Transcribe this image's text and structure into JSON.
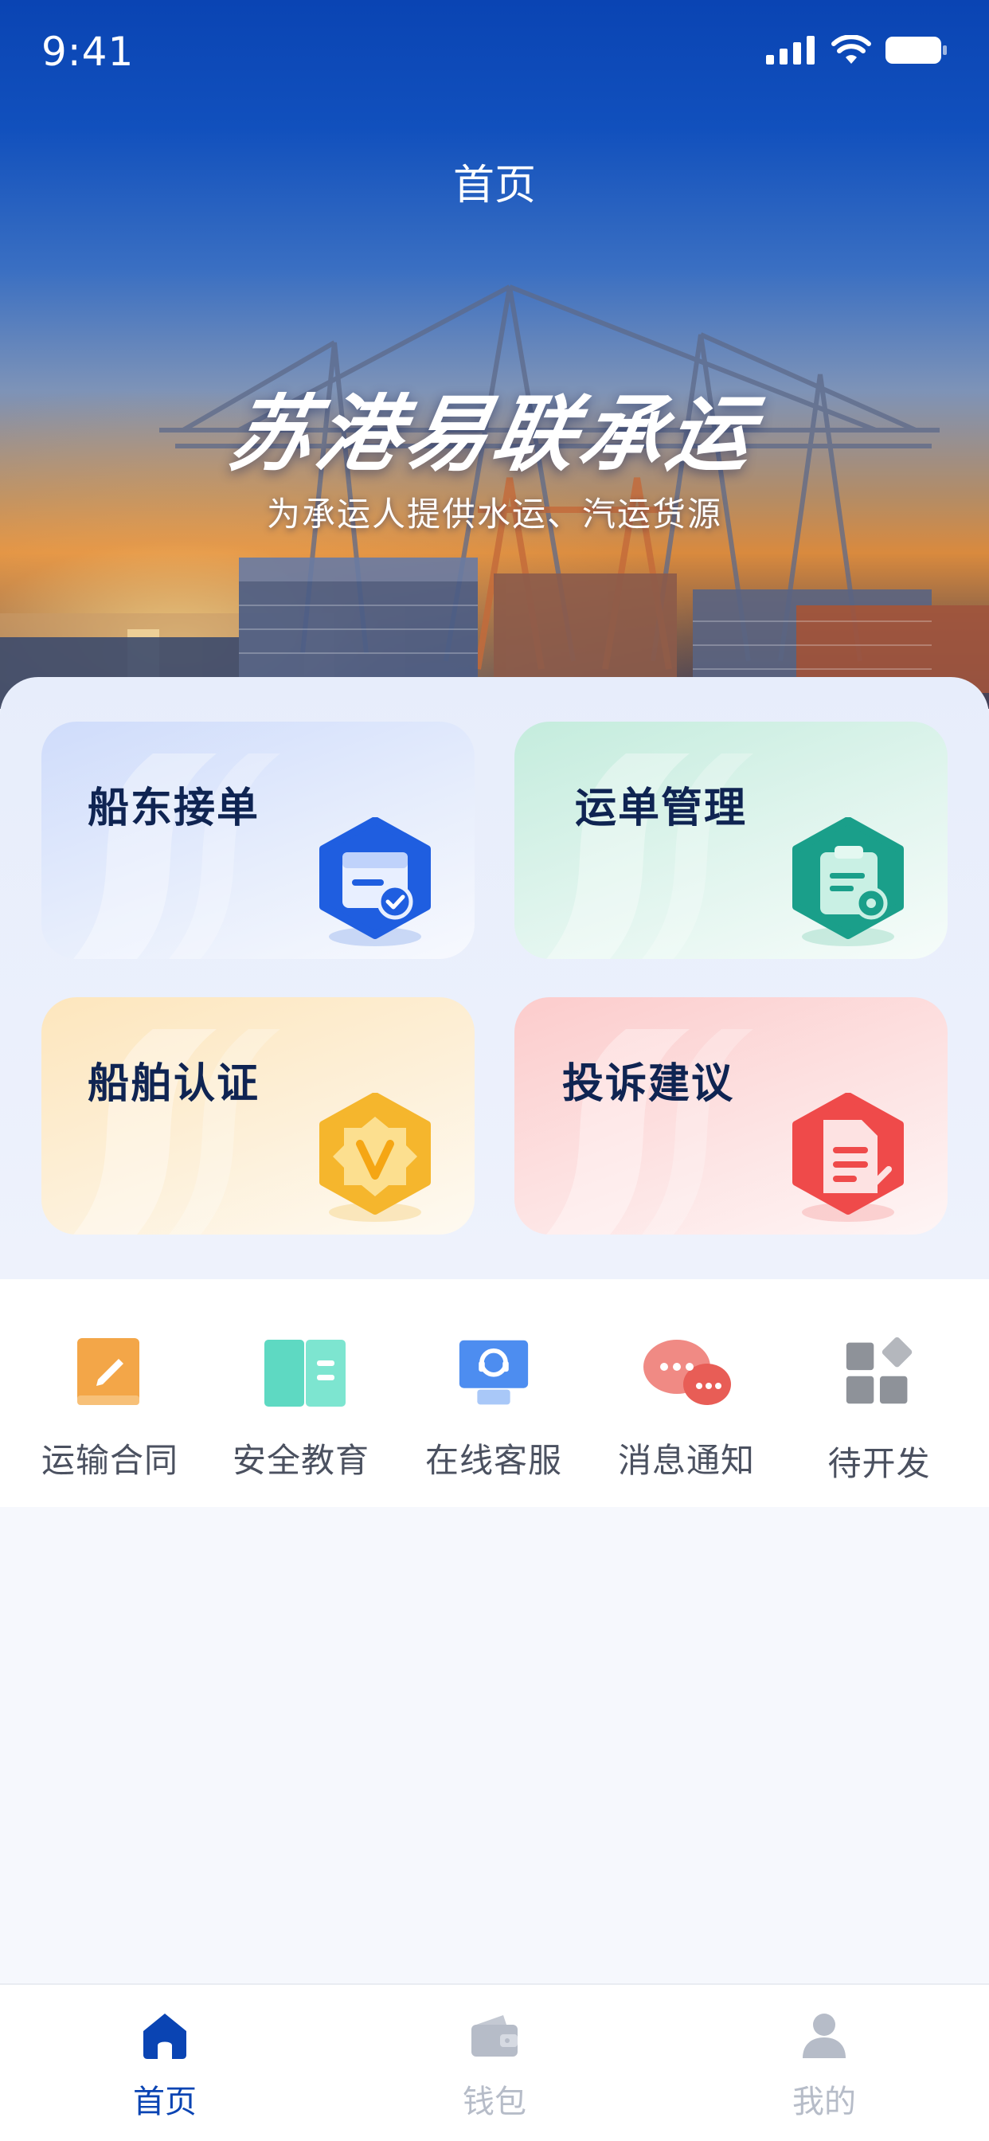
{
  "status_bar": {
    "time": "9:41"
  },
  "header": {
    "title": "首页",
    "brand": "苏港易联承运",
    "subtitle": "为承运人提供水运、汽运货源"
  },
  "cards": [
    {
      "label": "船东接单",
      "icon": "calendar-check-icon",
      "color": "#1f5ee0"
    },
    {
      "label": "运单管理",
      "icon": "clipboard-icon",
      "color": "#1a9f8a"
    },
    {
      "label": "船舶认证",
      "icon": "v-badge-icon",
      "color": "#f5b62d"
    },
    {
      "label": "投诉建议",
      "icon": "document-edit-icon",
      "color": "#ef4a4a"
    }
  ],
  "tools": [
    {
      "label": "运输合同",
      "icon": "contract-pencil-icon"
    },
    {
      "label": "安全教育",
      "icon": "book-icon"
    },
    {
      "label": "在线客服",
      "icon": "customer-service-icon"
    },
    {
      "label": "消息通知",
      "icon": "chat-bubbles-icon"
    },
    {
      "label": "待开发",
      "icon": "apps-grid-icon"
    }
  ],
  "tabbar": {
    "items": [
      {
        "label": "首页",
        "icon": "home-icon",
        "active": true
      },
      {
        "label": "钱包",
        "icon": "wallet-icon",
        "active": false
      },
      {
        "label": "我的",
        "icon": "user-icon",
        "active": false
      }
    ]
  },
  "colors": {
    "primary": "#0a44b3",
    "tab_inactive": "#b6bcc8"
  }
}
